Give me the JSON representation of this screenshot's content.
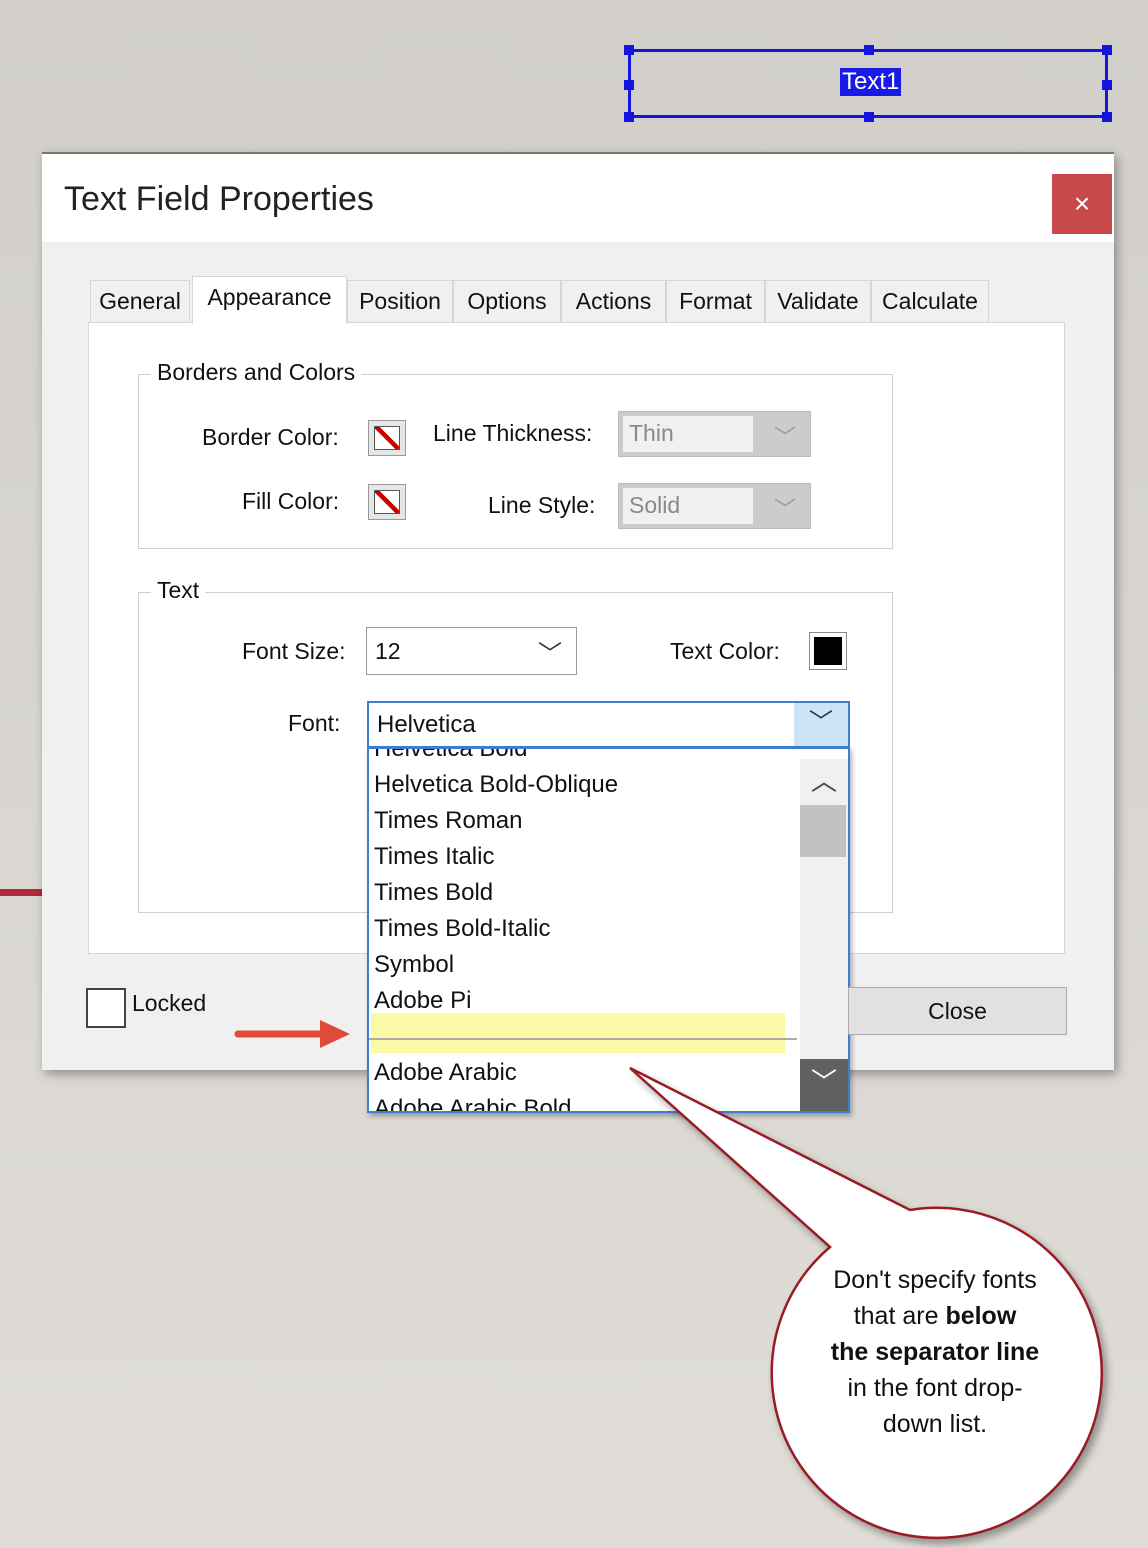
{
  "canvas": {
    "field_name": "Text1"
  },
  "dialog": {
    "title": "Text Field Properties",
    "close_icon": "×",
    "tabs": [
      "General",
      "Appearance",
      "Position",
      "Options",
      "Actions",
      "Format",
      "Validate",
      "Calculate"
    ],
    "active_tab": "Appearance",
    "borders_and_colors": {
      "legend": "Borders and Colors",
      "border_color_label": "Border Color:",
      "fill_color_label": "Fill Color:",
      "line_thickness_label": "Line Thickness:",
      "line_thickness_value": "Thin",
      "line_style_label": "Line Style:",
      "line_style_value": "Solid",
      "swatch_state": "transparent/no-color"
    },
    "text": {
      "legend": "Text",
      "font_size_label": "Font Size:",
      "font_size_value": "12",
      "text_color_label": "Text Color:",
      "text_color": "#000000",
      "font_label": "Font:",
      "font_value": "Helvetica",
      "font_options": [
        "Helvetica Bold",
        "Helvetica Bold-Oblique",
        "Times Roman",
        "Times Italic",
        "Times Bold",
        "Times Bold-Italic",
        "Symbol",
        "Adobe Pi",
        "Adobe Arabic",
        "Adobe Arabic Bold"
      ]
    },
    "locked_label": "Locked",
    "close_button": "Close"
  },
  "callout": {
    "line1": "Don't specify fonts",
    "line2_pre": "that are ",
    "line2_bold": "below",
    "line3_bold": "the separator line",
    "line4": "in the font drop-",
    "line5": "down list."
  },
  "colors": {
    "selection": "#1515e0",
    "close_red": "#c9484a",
    "highlight": "#fbf8a8",
    "arrow": "#e04a3a",
    "callout_border": "#9b1b24"
  }
}
